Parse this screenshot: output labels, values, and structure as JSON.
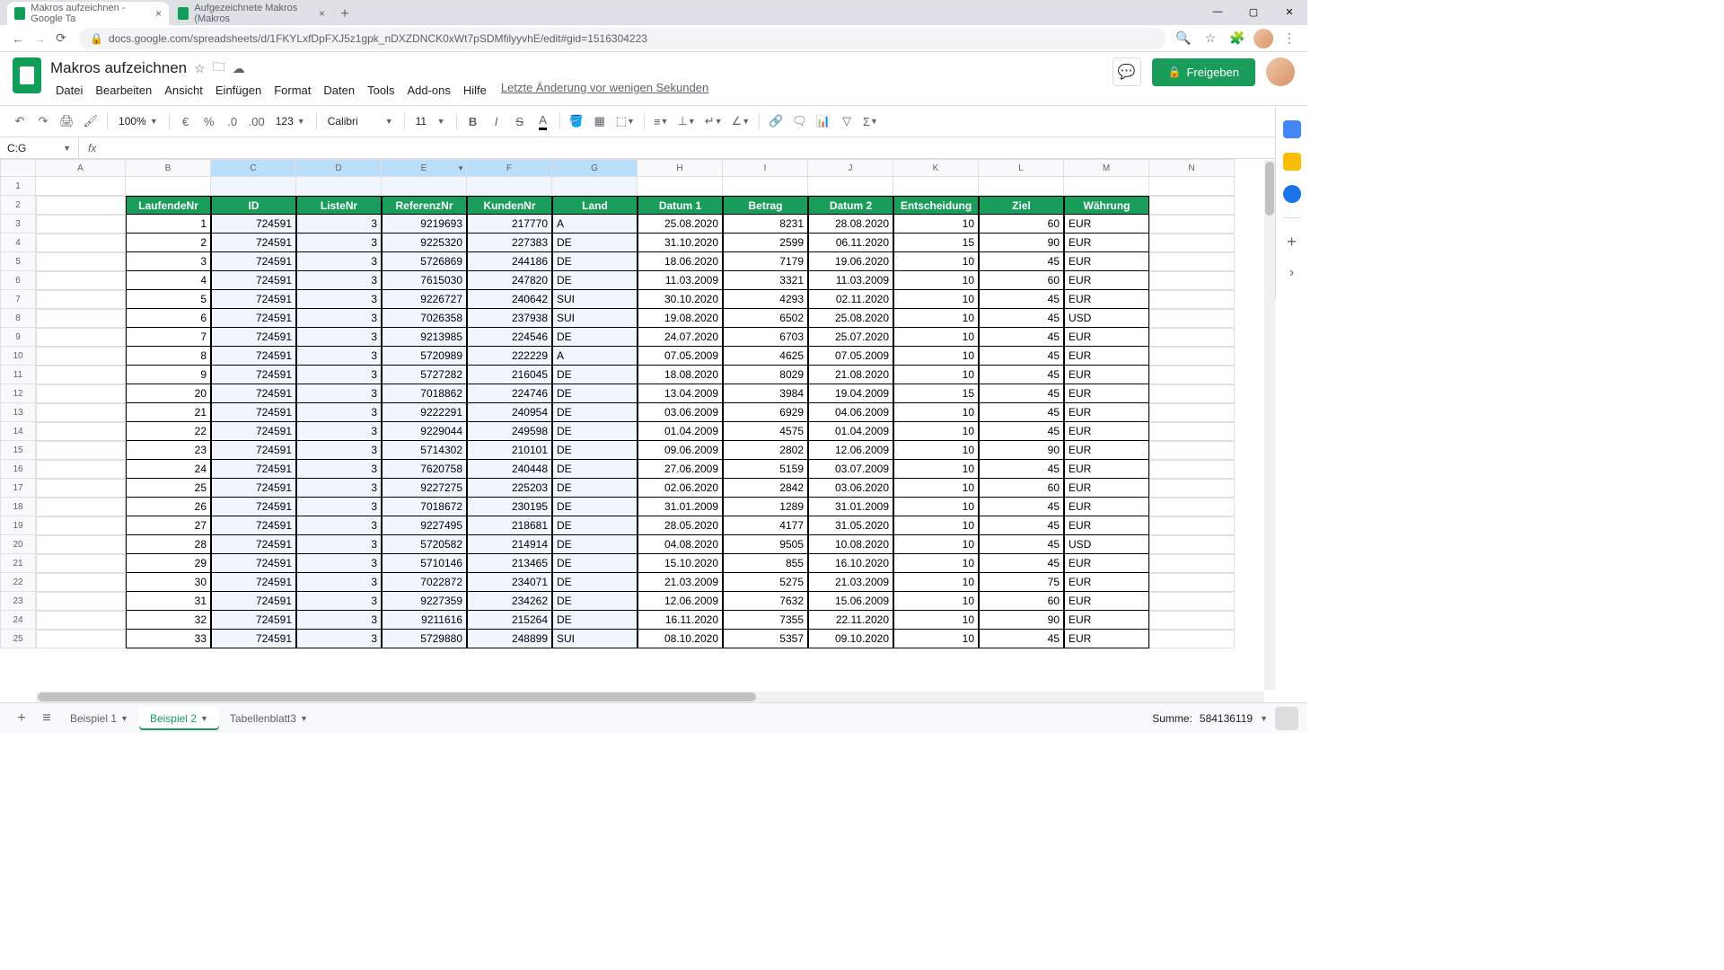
{
  "browser": {
    "tabs": [
      {
        "title": "Makros aufzeichnen - Google Ta"
      },
      {
        "title": "Aufgezeichnete Makros (Makros"
      }
    ],
    "url": "docs.google.com/spreadsheets/d/1FKYLxfDpFXJ5z1gpk_nDXZDNCK0xWt7pSDMfilyyvhE/edit#gid=1516304223"
  },
  "doc": {
    "title": "Makros aufzeichnen",
    "menus": [
      "Datei",
      "Bearbeiten",
      "Ansicht",
      "Einfügen",
      "Format",
      "Daten",
      "Tools",
      "Add-ons",
      "Hilfe"
    ],
    "last_edit": "Letzte Änderung vor wenigen Sekunden",
    "share": "Freigeben"
  },
  "toolbar": {
    "zoom": "100%",
    "currency": "€",
    "percent": "%",
    "dec_dec": ".0",
    "dec_inc": ".00",
    "more_formats": "123",
    "font": "Calibri",
    "size": "11"
  },
  "namebox": "C:G",
  "columns": [
    "A",
    "B",
    "C",
    "D",
    "E",
    "F",
    "G",
    "H",
    "I",
    "J",
    "K",
    "L",
    "M",
    "N"
  ],
  "row_numbers": [
    "1",
    "2",
    "3",
    "4",
    "5",
    "6",
    "7",
    "8",
    "9",
    "10",
    "11",
    "12",
    "13",
    "14",
    "15",
    "16",
    "17",
    "18",
    "19",
    "20",
    "21",
    "22",
    "23",
    "24",
    "25"
  ],
  "headers": [
    "LaufendeNr",
    "ID",
    "ListeNr",
    "ReferenzNr",
    "KundenNr",
    "Land",
    "Datum 1",
    "Betrag",
    "Datum 2",
    "Entscheidung",
    "Ziel",
    "Währung"
  ],
  "rows": [
    [
      "1",
      "724591",
      "3",
      "9219693",
      "217770",
      "A",
      "25.08.2020",
      "8231",
      "28.08.2020",
      "10",
      "60",
      "EUR"
    ],
    [
      "2",
      "724591",
      "3",
      "9225320",
      "227383",
      "DE",
      "31.10.2020",
      "2599",
      "06.11.2020",
      "15",
      "90",
      "EUR"
    ],
    [
      "3",
      "724591",
      "3",
      "5726869",
      "244186",
      "DE",
      "18.06.2020",
      "7179",
      "19.06.2020",
      "10",
      "45",
      "EUR"
    ],
    [
      "4",
      "724591",
      "3",
      "7615030",
      "247820",
      "DE",
      "11.03.2009",
      "3321",
      "11.03.2009",
      "10",
      "60",
      "EUR"
    ],
    [
      "5",
      "724591",
      "3",
      "9226727",
      "240642",
      "SUI",
      "30.10.2020",
      "4293",
      "02.11.2020",
      "10",
      "45",
      "EUR"
    ],
    [
      "6",
      "724591",
      "3",
      "7026358",
      "237938",
      "SUI",
      "19.08.2020",
      "6502",
      "25.08.2020",
      "10",
      "45",
      "USD"
    ],
    [
      "7",
      "724591",
      "3",
      "9213985",
      "224546",
      "DE",
      "24.07.2020",
      "6703",
      "25.07.2020",
      "10",
      "45",
      "EUR"
    ],
    [
      "8",
      "724591",
      "3",
      "5720989",
      "222229",
      "A",
      "07.05.2009",
      "4625",
      "07.05.2009",
      "10",
      "45",
      "EUR"
    ],
    [
      "9",
      "724591",
      "3",
      "5727282",
      "216045",
      "DE",
      "18.08.2020",
      "8029",
      "21.08.2020",
      "10",
      "45",
      "EUR"
    ],
    [
      "20",
      "724591",
      "3",
      "7018862",
      "224746",
      "DE",
      "13.04.2009",
      "3984",
      "19.04.2009",
      "15",
      "45",
      "EUR"
    ],
    [
      "21",
      "724591",
      "3",
      "9222291",
      "240954",
      "DE",
      "03.06.2009",
      "6929",
      "04.06.2009",
      "10",
      "45",
      "EUR"
    ],
    [
      "22",
      "724591",
      "3",
      "9229044",
      "249598",
      "DE",
      "01.04.2009",
      "4575",
      "01.04.2009",
      "10",
      "45",
      "EUR"
    ],
    [
      "23",
      "724591",
      "3",
      "5714302",
      "210101",
      "DE",
      "09.06.2009",
      "2802",
      "12.06.2009",
      "10",
      "90",
      "EUR"
    ],
    [
      "24",
      "724591",
      "3",
      "7620758",
      "240448",
      "DE",
      "27.06.2009",
      "5159",
      "03.07.2009",
      "10",
      "45",
      "EUR"
    ],
    [
      "25",
      "724591",
      "3",
      "9227275",
      "225203",
      "DE",
      "02.06.2020",
      "2842",
      "03.06.2020",
      "10",
      "60",
      "EUR"
    ],
    [
      "26",
      "724591",
      "3",
      "7018672",
      "230195",
      "DE",
      "31.01.2009",
      "1289",
      "31.01.2009",
      "10",
      "45",
      "EUR"
    ],
    [
      "27",
      "724591",
      "3",
      "9227495",
      "218681",
      "DE",
      "28.05.2020",
      "4177",
      "31.05.2020",
      "10",
      "45",
      "EUR"
    ],
    [
      "28",
      "724591",
      "3",
      "5720582",
      "214914",
      "DE",
      "04.08.2020",
      "9505",
      "10.08.2020",
      "10",
      "45",
      "USD"
    ],
    [
      "29",
      "724591",
      "3",
      "5710146",
      "213465",
      "DE",
      "15.10.2020",
      "855",
      "16.10.2020",
      "10",
      "45",
      "EUR"
    ],
    [
      "30",
      "724591",
      "3",
      "7022872",
      "234071",
      "DE",
      "21.03.2009",
      "5275",
      "21.03.2009",
      "10",
      "75",
      "EUR"
    ],
    [
      "31",
      "724591",
      "3",
      "9227359",
      "234262",
      "DE",
      "12.06.2009",
      "7632",
      "15.06.2009",
      "10",
      "60",
      "EUR"
    ],
    [
      "32",
      "724591",
      "3",
      "9211616",
      "215264",
      "DE",
      "16.11.2020",
      "7355",
      "22.11.2020",
      "10",
      "90",
      "EUR"
    ],
    [
      "33",
      "724591",
      "3",
      "5729880",
      "248899",
      "SUI",
      "08.10.2020",
      "5357",
      "09.10.2020",
      "10",
      "45",
      "EUR"
    ]
  ],
  "text_cols": [
    5,
    11
  ],
  "sheets": {
    "items": [
      "Beispiel 1",
      "Beispiel 2",
      "Tabellenblatt3"
    ],
    "active": 1
  },
  "footer": {
    "summary_label": "Summe:",
    "summary_value": "584136119"
  },
  "selected_cols": [
    "C",
    "D",
    "E",
    "F",
    "G"
  ]
}
